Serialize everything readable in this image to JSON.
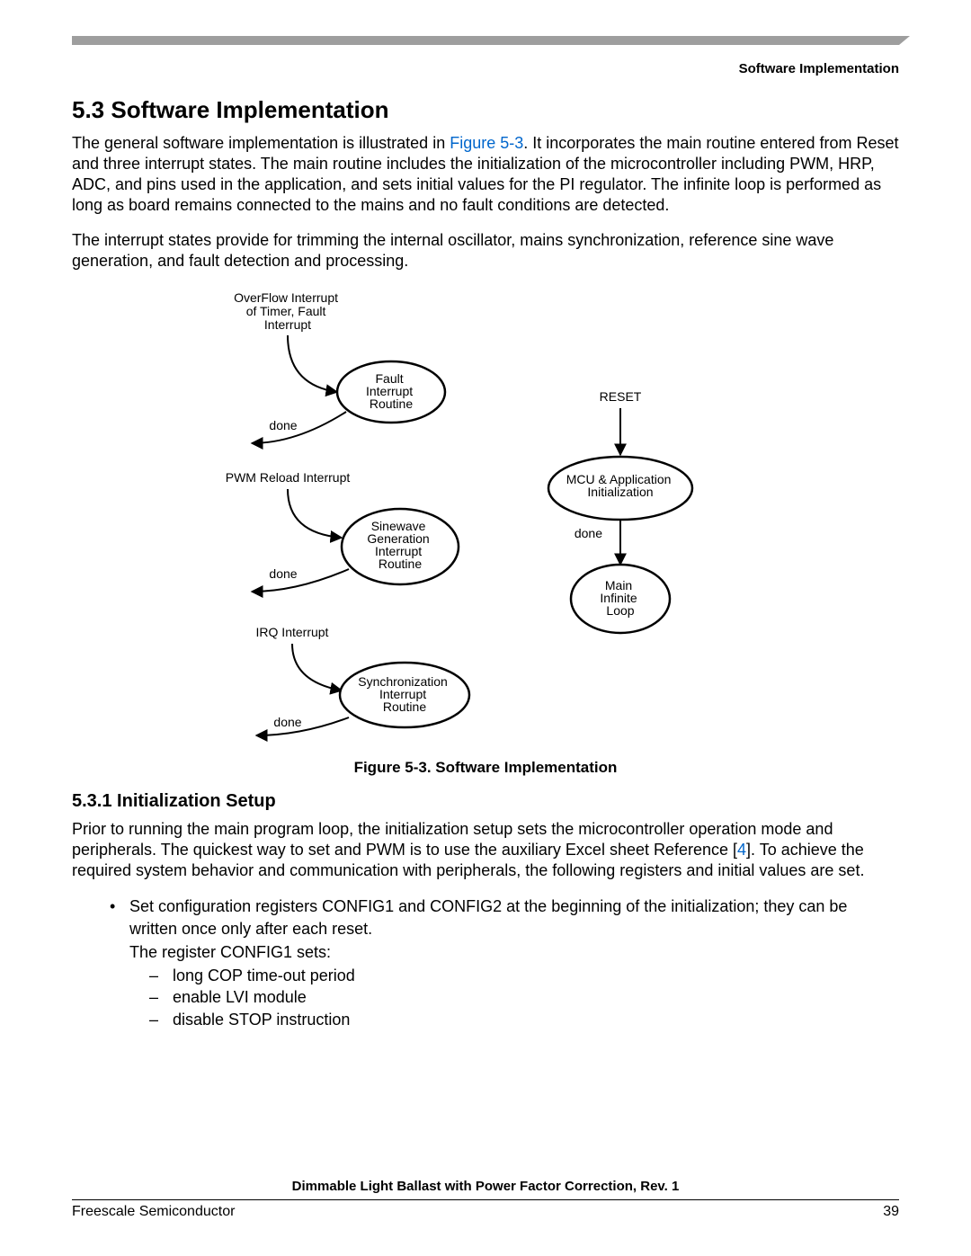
{
  "header": {
    "right": "Software Implementation"
  },
  "section": {
    "number_title": "5.3  Software Implementation",
    "para1_a": "The general software implementation is illustrated in ",
    "para1_link": "Figure 5-3",
    "para1_b": ". It incorporates the main routine entered from Reset and three interrupt states. The main routine includes the initialization of the microcontroller including PWM, HRP, ADC, and pins used in the application, and sets initial values for the PI regulator. The infinite loop is performed as long as board remains connected to the mains and no fault conditions are detected.",
    "para2": "The interrupt states provide for trimming the internal oscillator, mains synchronization, reference sine wave generation, and fault detection and processing."
  },
  "figure": {
    "labels": {
      "overflow": "OverFlow Interrupt of Timer, Fault Interrupt",
      "fault": "Fault Interrupt Routine",
      "pwm_reload": "PWM Reload Interrupt",
      "sine": "Sinewave Generation Interrupt Routine",
      "irq": "IRQ Interrupt",
      "sync": "Synchronization Interrupt Routine",
      "reset": "RESET",
      "init": "MCU & Application Initialization",
      "main": "Main Infinite Loop",
      "done": "done"
    },
    "caption": "Figure 5-3. Software Implementation"
  },
  "subsection": {
    "title": "5.3.1  Initialization Setup",
    "para_a": "Prior to running the main program loop, the initialization setup sets the microcontroller operation mode and peripherals. The quickest way to set and PWM is to use the auxiliary Excel sheet Reference [",
    "para_link": "4",
    "para_b": "]. To achieve the required system behavior and communication with peripherals, the following registers and initial values are set.",
    "bullets": {
      "b1": "Set configuration registers CONFIG1 and CONFIG2 at the beginning of the initialization; they can be written once only after each reset.",
      "b1_sub": "The register CONFIG1 sets:",
      "dashes": {
        "d1": "long COP time-out period",
        "d2": "enable LVI module",
        "d3": "disable STOP instruction"
      }
    }
  },
  "footer": {
    "title": "Dimmable Light Ballast with Power Factor Correction, Rev. 1",
    "left": "Freescale Semiconductor",
    "right": "39"
  }
}
